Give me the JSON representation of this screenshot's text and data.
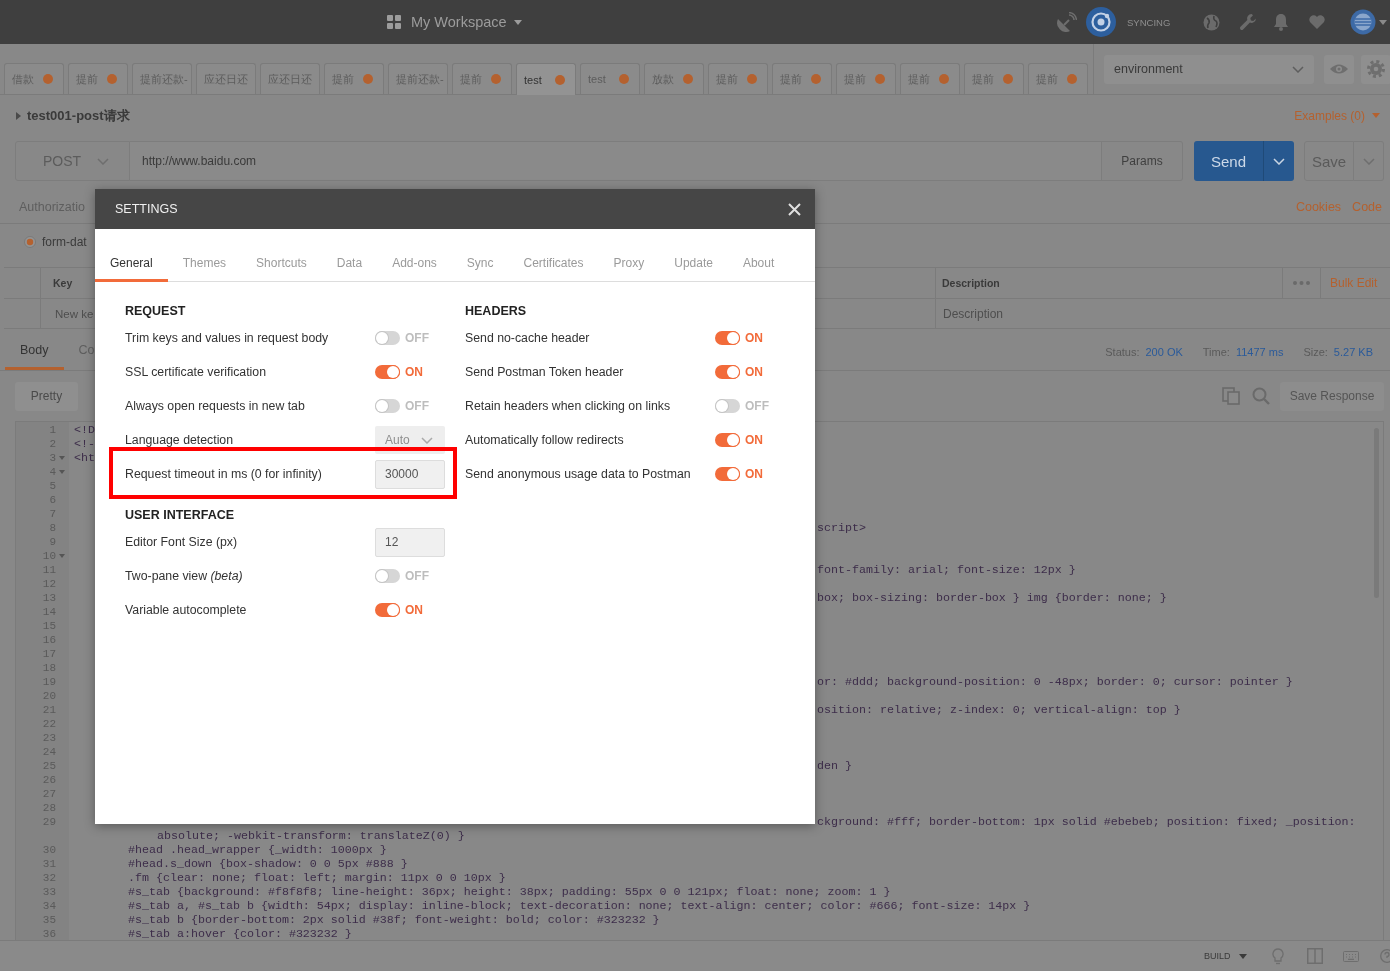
{
  "header": {
    "workspace": "My Workspace",
    "sync_status": "SYNCING"
  },
  "tabs": [
    {
      "label": "借款",
      "unsaved": true,
      "selected": false
    },
    {
      "label": "提前",
      "unsaved": true,
      "selected": false
    },
    {
      "label": "提前还款-",
      "unsaved": false,
      "selected": false
    },
    {
      "label": "应还日还",
      "unsaved": false,
      "selected": false
    },
    {
      "label": "应还日还",
      "unsaved": false,
      "selected": false
    },
    {
      "label": "提前",
      "unsaved": true,
      "selected": false
    },
    {
      "label": "提前还款-",
      "unsaved": false,
      "selected": false
    },
    {
      "label": "提前",
      "unsaved": true,
      "selected": false
    },
    {
      "label": "test",
      "unsaved": true,
      "selected": true
    },
    {
      "label": "test",
      "unsaved": true,
      "selected": false
    },
    {
      "label": "放款",
      "unsaved": true,
      "selected": false
    },
    {
      "label": "提前",
      "unsaved": true,
      "selected": false
    },
    {
      "label": "提前",
      "unsaved": true,
      "selected": false
    },
    {
      "label": "提前",
      "unsaved": true,
      "selected": false
    },
    {
      "label": "提前",
      "unsaved": true,
      "selected": false
    },
    {
      "label": "提前",
      "unsaved": true,
      "selected": false
    },
    {
      "label": "提前",
      "unsaved": true,
      "selected": false
    }
  ],
  "environment": {
    "value": "environment"
  },
  "request": {
    "title": "test001-post请求",
    "examples": "Examples (0)",
    "method": "POST",
    "url": "http://www.baidu.com",
    "params": "Params",
    "send": "Send",
    "save": "Save"
  },
  "request_tabs": [
    {
      "label": "Authorizatio",
      "selected": false
    }
  ],
  "request_links": [
    "Cookies",
    "Code"
  ],
  "body_types": [
    {
      "label": "form-dat",
      "selected": true
    }
  ],
  "params_table": {
    "columns": [
      "Key",
      "Description"
    ],
    "bulk_edit": "Bulk Edit",
    "key_placeholder": "New ke",
    "description_placeholder": "Description"
  },
  "response": {
    "tabs": [
      {
        "label": "Body",
        "selected": true
      },
      {
        "label": "Co",
        "selected": false
      }
    ],
    "stats": [
      {
        "label": "Status:",
        "value": "200 OK"
      },
      {
        "label": "Time:",
        "value": "11477 ms"
      },
      {
        "label": "Size:",
        "value": "5.27 KB"
      }
    ],
    "view": "Pretty",
    "save_response": "Save Response"
  },
  "code_lines": [
    {
      "number": "1",
      "fold": false,
      "kind": "top",
      "text": "<!D"
    },
    {
      "number": "2",
      "fold": false,
      "kind": "top",
      "text": "<!-"
    },
    {
      "number": "3",
      "fold": true,
      "kind": "top",
      "text": "<ht"
    },
    {
      "number": "4",
      "fold": true
    },
    {
      "number": "5",
      "fold": false
    },
    {
      "number": "6",
      "fold": false
    },
    {
      "number": "7",
      "fold": false
    },
    {
      "number": "8",
      "fold": false,
      "kind": "tail",
      "text": "script>"
    },
    {
      "number": "9",
      "fold": false
    },
    {
      "number": "10",
      "fold": true
    },
    {
      "number": "11",
      "fold": false,
      "kind": "tail",
      "text": "font-family: arial; font-size: 12px }"
    },
    {
      "number": "12",
      "fold": false
    },
    {
      "number": "13",
      "fold": false,
      "kind": "tail",
      "text": "box; box-sizing: border-box } img {border: none; }"
    },
    {
      "number": "14",
      "fold": false
    },
    {
      "number": "15",
      "fold": false
    },
    {
      "number": "16",
      "fold": false
    },
    {
      "number": "17",
      "fold": false
    },
    {
      "number": "18",
      "fold": false
    },
    {
      "number": "19",
      "fold": false,
      "kind": "tail",
      "text": "or: #ddd; background-position: 0 -48px; border: 0; cursor: pointer }"
    },
    {
      "number": "20",
      "fold": false
    },
    {
      "number": "21",
      "fold": false,
      "kind": "tail",
      "text": "osition: relative; z-index: 0; vertical-align: top }"
    },
    {
      "number": "22",
      "fold": false
    },
    {
      "number": "23",
      "fold": false
    },
    {
      "number": "24",
      "fold": false
    },
    {
      "number": "25",
      "fold": false,
      "kind": "tail",
      "text": "den }"
    },
    {
      "number": "26",
      "fold": false
    },
    {
      "number": "27",
      "fold": false
    },
    {
      "number": "28",
      "fold": false
    },
    {
      "number": "29",
      "fold": false,
      "kind": "tail",
      "text": "ckground: #fff; border-bottom: 1px solid #ebebeb; position: fixed; _position:"
    },
    {
      "fold": false,
      "kind": "wrap",
      "text": "absolute; -webkit-transform: translateZ(0) }"
    },
    {
      "number": "30",
      "fold": false,
      "kind": "nested",
      "text": "#head .head_wrapper {_width: 1000px }"
    },
    {
      "number": "31",
      "fold": false,
      "kind": "nested",
      "text": "#head.s_down {box-shadow: 0 0 5px #888 }"
    },
    {
      "number": "32",
      "fold": false,
      "kind": "nested",
      "text": ".fm {clear: none; float: left; margin: 11px 0 0 10px }"
    },
    {
      "number": "33",
      "fold": false,
      "kind": "nested",
      "text": "#s_tab {background: #f8f8f8; line-height: 36px; height: 38px; padding: 55px 0 0 121px; float: none; zoom: 1 }"
    },
    {
      "number": "34",
      "fold": false,
      "kind": "nested",
      "text": "#s_tab a, #s_tab b {width: 54px; display: inline-block; text-decoration: none; text-align: center; color: #666; font-size: 14px }"
    },
    {
      "number": "35",
      "fold": false,
      "kind": "nested",
      "text": "#s_tab b {border-bottom: 2px solid #38f; font-weight: bold; color: #323232 }"
    },
    {
      "number": "36",
      "fold": false,
      "kind": "nested",
      "text": "#s_tab a:hover {color: #323232 }"
    }
  ],
  "status_bar": {
    "build": "BUILD"
  },
  "settings": {
    "title": "SETTINGS",
    "tabs": [
      {
        "label": "General",
        "selected": true
      },
      {
        "label": "Themes",
        "selected": false
      },
      {
        "label": "Shortcuts",
        "selected": false
      },
      {
        "label": "Data",
        "selected": false
      },
      {
        "label": "Add-ons",
        "selected": false
      },
      {
        "label": "Sync",
        "selected": false
      },
      {
        "label": "Certificates",
        "selected": false
      },
      {
        "label": "Proxy",
        "selected": false
      },
      {
        "label": "Update",
        "selected": false
      },
      {
        "label": "About",
        "selected": false
      }
    ],
    "columns": [
      {
        "sections": [
          {
            "heading": "REQUEST",
            "rows": [
              {
                "kind": "toggle",
                "label": "Trim keys and values in request body",
                "on": false,
                "state_text": "OFF",
                "highlighted": false
              },
              {
                "kind": "toggle",
                "label": "SSL certificate verification",
                "on": true,
                "state_text": "ON",
                "highlighted": false
              },
              {
                "kind": "toggle",
                "label": "Always open requests in new tab",
                "on": false,
                "state_text": "OFF",
                "highlighted": false
              },
              {
                "kind": "select",
                "label": "Language detection",
                "value": "Auto",
                "highlighted": false
              },
              {
                "kind": "input",
                "label": "Request timeout in ms (0 for infinity)",
                "value": "30000",
                "highlighted": true
              }
            ]
          },
          {
            "heading": "USER INTERFACE",
            "rows": [
              {
                "kind": "input",
                "label": "Editor Font Size (px)",
                "value": "12",
                "highlighted": false
              },
              {
                "kind": "toggle",
                "label": "Two-pane view *(beta)*",
                "on": false,
                "state_text": "OFF",
                "highlighted": false
              },
              {
                "kind": "toggle",
                "label": "Variable autocomplete",
                "on": true,
                "state_text": "ON",
                "highlighted": false
              }
            ]
          }
        ]
      },
      {
        "sections": [
          {
            "heading": "HEADERS",
            "rows": [
              {
                "kind": "toggle",
                "label": "Send no-cache header",
                "on": true,
                "state_text": "ON",
                "highlighted": false
              },
              {
                "kind": "toggle",
                "label": "Send Postman Token header",
                "on": true,
                "state_text": "ON",
                "highlighted": false
              },
              {
                "kind": "toggle",
                "label": "Retain headers when clicking on links",
                "on": false,
                "state_text": "OFF",
                "highlighted": false
              },
              {
                "kind": "toggle",
                "label": "Automatically follow redirects",
                "on": true,
                "state_text": "ON",
                "highlighted": false
              },
              {
                "kind": "toggle",
                "label": "Send anonymous usage data to Postman",
                "on": true,
                "state_text": "ON",
                "highlighted": false
              }
            ]
          }
        ]
      }
    ]
  }
}
